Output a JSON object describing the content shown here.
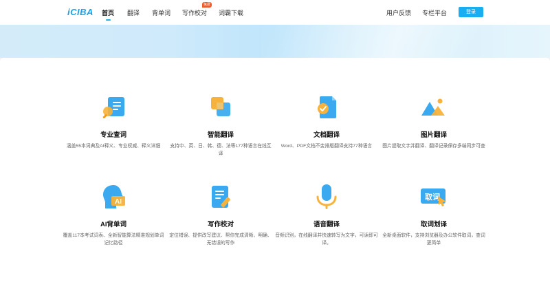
{
  "header": {
    "logo": "iCIBA",
    "nav": [
      {
        "label": "首页",
        "active": true
      },
      {
        "label": "翻译",
        "active": false
      },
      {
        "label": "背单词",
        "active": false
      },
      {
        "label": "写作校对",
        "active": false
      },
      {
        "label": "词霸下载",
        "active": false
      }
    ],
    "badge": "免费",
    "feedback": "用户反馈",
    "column": "专栏平台",
    "login": "登录"
  },
  "colors": {
    "accent": "#18aef0",
    "badge": "#f05a28",
    "icon_blue": "#3aa9ef",
    "icon_orange": "#f7b23b"
  },
  "features": [
    {
      "title": "专业查词",
      "desc": "涵盖55本词典及AI释义、专业权威、释义详细",
      "icon": "search-book-icon"
    },
    {
      "title": "智能翻译",
      "desc": "支持中、英、日、韩、德、法等177种语言在线互译",
      "icon": "translate-cards-icon"
    },
    {
      "title": "文档翻译",
      "desc": "Word、PDF文档不变排版翻译支持77种语言",
      "icon": "document-check-icon"
    },
    {
      "title": "图片翻译",
      "desc": "图片提取文字并翻译、翻译记录保存多端同步可查",
      "icon": "image-mountain-icon"
    },
    {
      "title": "AI背单词",
      "desc": "覆盖117本考试词表、全新智能算法精准规划单词记忆路径",
      "icon": "ai-head-icon"
    },
    {
      "title": "写作校对",
      "desc": "定位错误、提供改写建议、帮你完成清晰、明确、无错误的写作",
      "icon": "note-pencil-icon"
    },
    {
      "title": "语音翻译",
      "desc": "音频识别，在线翻译并快速转写为文字，可读即可译。",
      "icon": "microphone-icon"
    },
    {
      "title": "取词划译",
      "desc": "全新桌面软件，支持浏览器及办公软件取词，查词更简单",
      "icon": "pick-word-icon"
    }
  ]
}
